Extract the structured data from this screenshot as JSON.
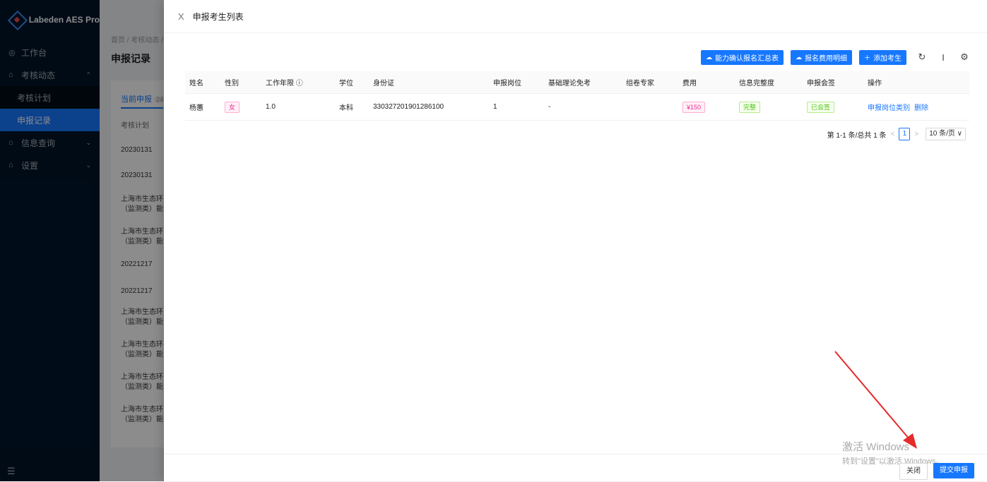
{
  "sidebar": {
    "app_name": "Labeden AES Pro",
    "menu": [
      {
        "label": "工作台",
        "icon": "dashboard-icon"
      },
      {
        "label": "考核动态",
        "icon": "home-icon",
        "arrow": "^"
      },
      {
        "label": "考核计划"
      },
      {
        "label": "申报记录"
      },
      {
        "label": "信息查询",
        "icon": "home-icon",
        "arrow": "v"
      },
      {
        "label": "设置",
        "icon": "home-icon",
        "arrow": "v"
      }
    ],
    "footer_icon": "☰"
  },
  "background": {
    "breadcrumb": "首页 / 考核动态 /",
    "title": "申报记录",
    "tab_label": "当前申报",
    "tab_count": "24",
    "column_header": "考核计划",
    "rows": [
      "20230131",
      "20230131",
      "上海市生态环|（监测类）能",
      "上海市生态环|（监测类）能",
      "20221217",
      "20221217",
      "上海市生态环|（监测类）能",
      "上海市生态环|（监测类）能",
      "上海市生态环|（监测类）能",
      "上海市生态环|（监测类）能"
    ]
  },
  "drawer": {
    "close_icon": "X",
    "title": "申报考生列表",
    "toolbar": {
      "btn_summary": "能力确认报名汇总表",
      "btn_fee_detail": "报名费用明细",
      "btn_add": "添加考生",
      "icons": [
        "reload-icon",
        "column-height-icon",
        "setting-icon"
      ]
    },
    "table": {
      "headers": [
        "姓名",
        "性别",
        "工作年限 ⓘ",
        "学位",
        "身份证",
        "申报岗位",
        "基础理论免考",
        "组卷专家",
        "费用",
        "信息完整度",
        "申报会签",
        "操作"
      ],
      "rows": [
        {
          "name": "杨蕙",
          "gender": "女",
          "years": "1.0",
          "degree": "本科",
          "id_card": "330327201901286100",
          "position": "1",
          "exempt": "-",
          "expert": "",
          "fee": "¥150",
          "completeness": "完整",
          "signoff": "已会签",
          "action_edit": "申报岗位类别",
          "action_delete": "删除"
        }
      ]
    },
    "pagination": {
      "summary": "第 1-1 条/总共 1 条",
      "current": "1",
      "page_size": "10 条/页 ∨"
    },
    "watermark": {
      "line1": "激活 Windows",
      "line2": "转到\"设置\"以激活 Windows。"
    },
    "footer": {
      "close": "关闭",
      "submit": "提交申报"
    }
  },
  "colors": {
    "primary": "#1677ff",
    "sidebar": "#001529",
    "annotation_arrow": "#e52b2b"
  }
}
